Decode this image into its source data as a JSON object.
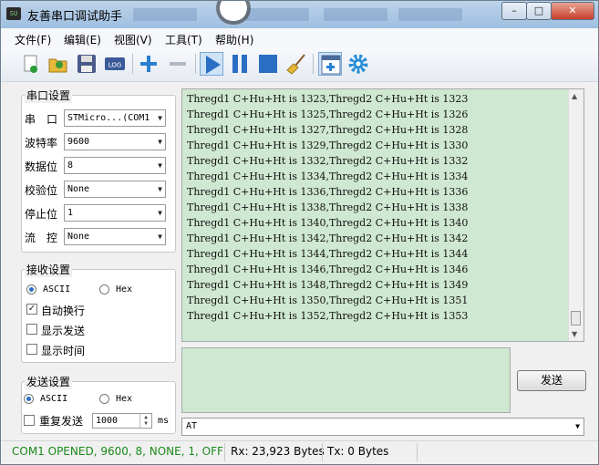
{
  "window": {
    "title": "友善串口调试助手",
    "app_icon_text": "SU",
    "controls": [
      "minimize-icon",
      "maximize-icon",
      "close-icon"
    ]
  },
  "menu": [
    "文件(F)",
    "编辑(E)",
    "视图(V)",
    "工具(T)",
    "帮助(H)"
  ],
  "toolbar": {
    "icons": [
      "new-icon",
      "open-icon",
      "save-icon",
      "log-icon",
      "add-icon",
      "remove-icon",
      "play-icon",
      "pause-icon",
      "stop-icon",
      "clear-broom-icon",
      "window-add-icon",
      "settings-gear-icon"
    ],
    "log_label": "LOG"
  },
  "serial_settings": {
    "title": "串口设置",
    "fields": [
      {
        "label": "串　口",
        "value": "STMicro...(COM1"
      },
      {
        "label": "波特率",
        "value": "9600"
      },
      {
        "label": "数据位",
        "value": "8"
      },
      {
        "label": "校验位",
        "value": "None"
      },
      {
        "label": "停止位",
        "value": "1"
      },
      {
        "label": "流　控",
        "value": "None"
      }
    ]
  },
  "receive_settings": {
    "title": "接收设置",
    "radio_ascii": "ASCII",
    "radio_hex": "Hex",
    "selected": "ASCII",
    "checks": [
      {
        "label": "自动换行",
        "checked": true
      },
      {
        "label": "显示发送",
        "checked": false
      },
      {
        "label": "显示时间",
        "checked": false
      }
    ]
  },
  "send_settings": {
    "title": "发送设置",
    "radio_ascii": "ASCII",
    "radio_hex": "Hex",
    "selected": "ASCII",
    "repeat_label": "重复发送",
    "repeat_checked": false,
    "interval": "1000",
    "unit": "ms"
  },
  "receive_lines": [
    "Thregd1 C+Hu+Ht is 1323,Thregd2 C+Hu+Ht is 1323",
    "Thregd1 C+Hu+Ht is 1325,Thregd2 C+Hu+Ht is 1326",
    "Thregd1 C+Hu+Ht is 1327,Thregd2 C+Hu+Ht is 1328",
    "Thregd1 C+Hu+Ht is 1329,Thregd2 C+Hu+Ht is 1330",
    "Thregd1 C+Hu+Ht is 1332,Thregd2 C+Hu+Ht is 1332",
    "Thregd1 C+Hu+Ht is 1334,Thregd2 C+Hu+Ht is 1334",
    "Thregd1 C+Hu+Ht is 1336,Thregd2 C+Hu+Ht is 1336",
    "Thregd1 C+Hu+Ht is 1338,Thregd2 C+Hu+Ht is 1338",
    "Thregd1 C+Hu+Ht is 1340,Thregd2 C+Hu+Ht is 1340",
    "Thregd1 C+Hu+Ht is 1342,Thregd2 C+Hu+Ht is 1342",
    "Thregd1 C+Hu+Ht is 1344,Thregd2 C+Hu+Ht is 1344",
    "Thregd1 C+Hu+Ht is 1346,Thregd2 C+Hu+Ht is 1346",
    "Thregd1 C+Hu+Ht is 1348,Thregd2 C+Hu+Ht is 1349",
    "Thregd1 C+Hu+Ht is 1350,Thregd2 C+Hu+Ht is 1351",
    "Thregd1 C+Hu+Ht is 1352,Thregd2 C+Hu+Ht is 1353"
  ],
  "send": {
    "button_label": "发送",
    "command_value": "AT"
  },
  "status": {
    "connection": "COM1 OPENED, 9600, 8, NONE, 1, OFF",
    "rx": "Rx: 23,923 Bytes",
    "tx": "Tx: 0 Bytes"
  },
  "colors": {
    "text_area_bg": "#cfe8d1",
    "status_green": "#1a8a1a",
    "accent_blue": "#2a6fc4"
  }
}
